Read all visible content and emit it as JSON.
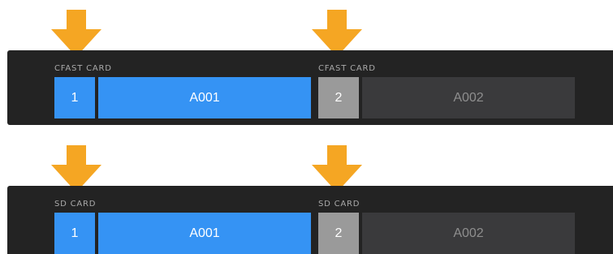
{
  "accent_colors": {
    "arrow": "#f5a623",
    "active_slot": "#3593f4",
    "inactive_slot_number": "#9a9a9a",
    "inactive_slot_clip": "#3a3a3c",
    "panel": "#232323"
  },
  "panels": [
    {
      "media_type": "CFAST",
      "slots": [
        {
          "label": "CFAST CARD",
          "number": "1",
          "clip": "A001",
          "state": "active"
        },
        {
          "label": "CFAST CARD",
          "number": "2",
          "clip": "A002",
          "state": "inactive"
        }
      ]
    },
    {
      "media_type": "SD",
      "slots": [
        {
          "label": "SD CARD",
          "number": "1",
          "clip": "A001",
          "state": "active"
        },
        {
          "label": "SD CARD",
          "number": "2",
          "clip": "A002",
          "state": "inactive"
        }
      ]
    }
  ],
  "icons": {
    "pointer": "arrow-down-icon"
  }
}
